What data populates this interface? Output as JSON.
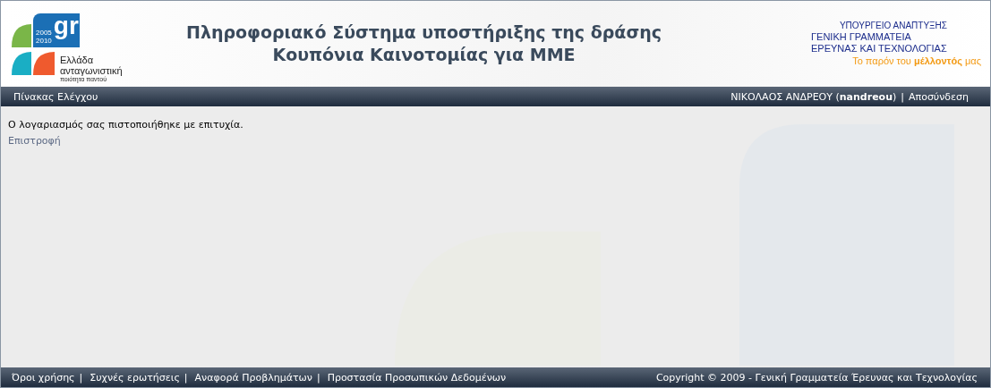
{
  "header": {
    "logo": {
      "mark": "gr",
      "years": [
        "2005",
        "2010"
      ],
      "line1": "Ελλάδα",
      "line2": "ανταγωνιστική",
      "tagline": "ποιότητα παντού"
    },
    "title_lines": [
      "Πληροφοριακό Σύστημα υποστήριξης της δράσης",
      "Κουπόνια Καινοτομίας για ΜΜΕ"
    ],
    "ministry": {
      "line1": "ΥΠΟΥΡΓΕΙΟ ΑΝΑΠΤΥΞΗΣ",
      "line2": "ΓΕΝΙΚΗ ΓΡΑΜΜΑΤΕΙΑ",
      "line3": "ΕΡΕΥΝΑΣ ΚΑΙ ΤΕΧΝΟΛΟΓΙΑΣ",
      "slogan": "Το παρόν του **μέλλοντός** μας"
    }
  },
  "nav": {
    "left": "Πίνακας Ελέγχου",
    "user_name": "ΝΙΚΟΛΑΟΣ ΑΝΔΡΕΟΥ (**nandreou**)",
    "separator": "|",
    "logout": "Αποσύνδεση"
  },
  "content": {
    "message": "Ο λογαριασμός σας πιστοποιήθηκε με επιτυχία.",
    "back_link": "Επιστροφή"
  },
  "footer": {
    "links": [
      "Όροι χρήσης",
      "Συχνές ερωτήσεις",
      "Αναφορά Προβλημάτων",
      "Προστασία Προσωπικών Δεδομένων"
    ],
    "separators": [
      "|",
      "|",
      "|"
    ],
    "copyright": "Copyright © 2009 - Γενική Γραμματεία Έρευνας και Τεχνολογίας"
  }
}
